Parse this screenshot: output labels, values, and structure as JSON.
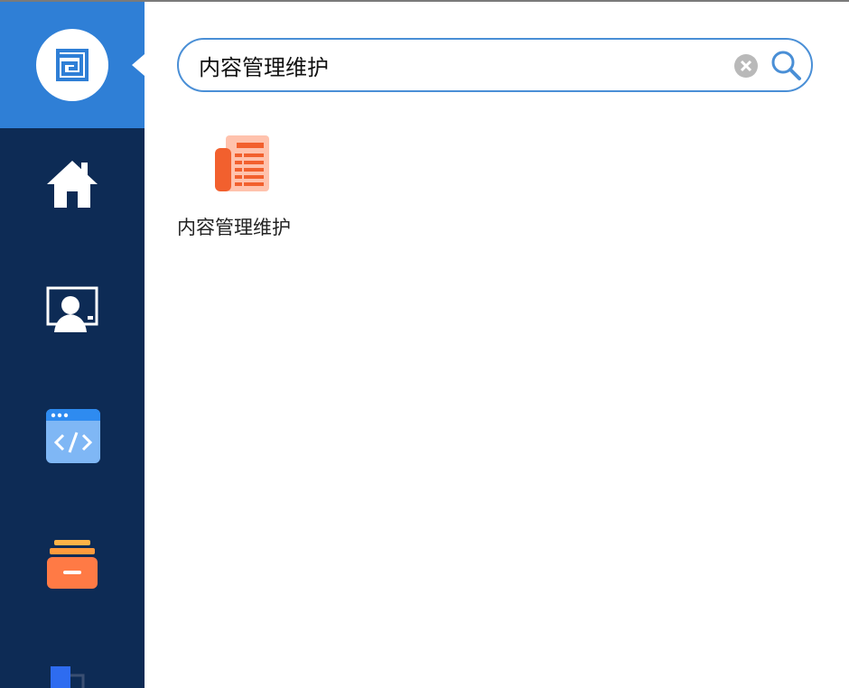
{
  "search": {
    "value": "内容管理维护",
    "clear_icon": "clear-icon",
    "search_icon": "search-icon"
  },
  "sidebar": {
    "logo_icon": "app-logo-icon",
    "items": [
      {
        "icon": "home-icon"
      },
      {
        "icon": "monitor-user-icon"
      },
      {
        "icon": "code-window-icon"
      },
      {
        "icon": "archive-box-icon"
      },
      {
        "icon": "blocks-icon"
      }
    ]
  },
  "results": [
    {
      "label": "内容管理维护",
      "icon": "newspaper-icon"
    }
  ],
  "colors": {
    "sidebar_bg": "#0d2b55",
    "sidebar_header_bg": "#2f7fd6",
    "search_border": "#4a8fd6",
    "result_icon": "#f2602e",
    "archive_icon": "#ff7a45"
  }
}
